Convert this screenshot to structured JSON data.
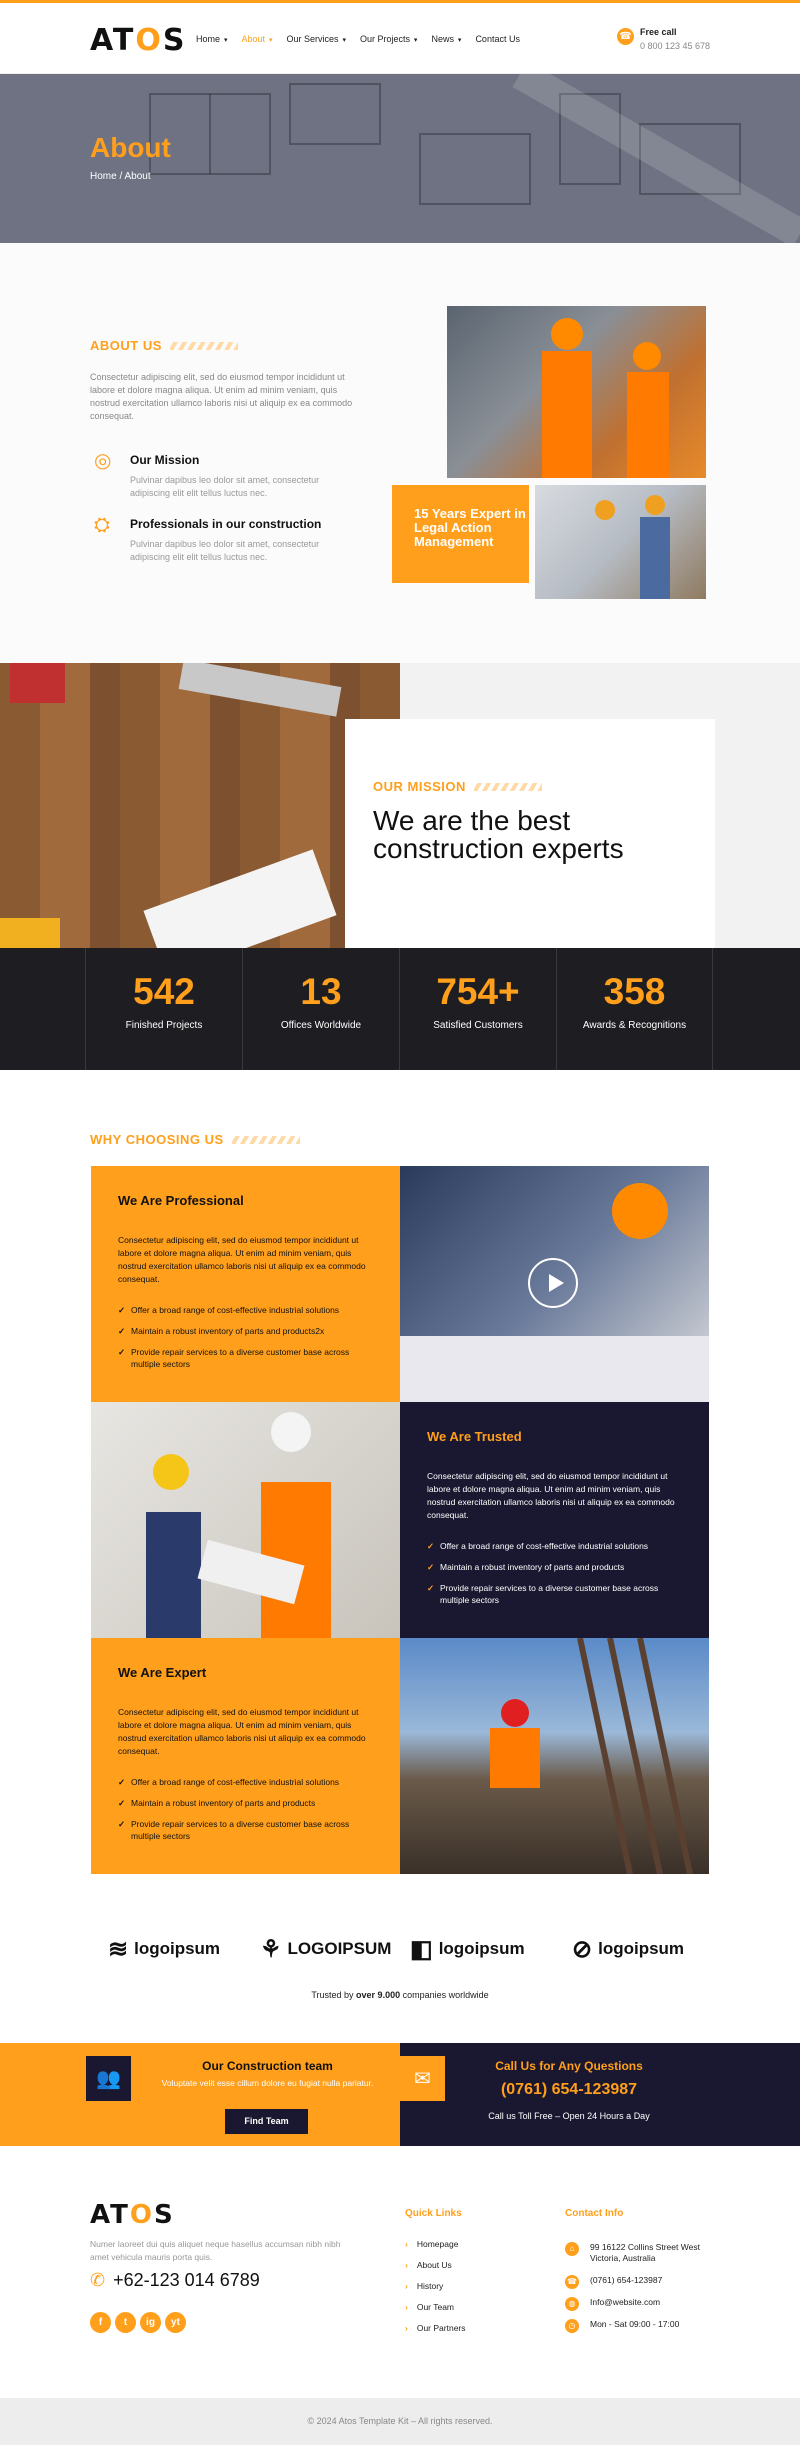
{
  "header": {
    "logo_pre": "AT",
    "logo_o": "O",
    "logo_post": "S",
    "nav": [
      {
        "label": "Home"
      },
      {
        "label": "About"
      },
      {
        "label": "Our Services"
      },
      {
        "label": "Our Projects"
      },
      {
        "label": "News"
      },
      {
        "label": "Contact Us"
      }
    ],
    "call_title": "Free call",
    "call_number": "0 800 123 45 678"
  },
  "hero": {
    "title": "About",
    "breadcrumb": "Home / About"
  },
  "about": {
    "eyebrow": "ABOUT US",
    "description": "Consectetur adipiscing elit, sed do eiusmod tempor incididunt ut labore et dolore magna aliqua. Ut enim ad minim veniam, quis nostrud exercitation ullamco laboris nisi ut aliquip ex ea commodo consequat.",
    "features": [
      {
        "icon": "target-icon",
        "title": "Our Mission",
        "text": "Pulvinar dapibus leo dolor sit amet, consectetur adipiscing elit elit tellus luctus nec."
      },
      {
        "icon": "crane-icon",
        "title": "Professionals in our construction",
        "text": "Pulvinar dapibus leo dolor sit amet, consectetur adipiscing elit elit tellus luctus nec."
      }
    ],
    "badge": "15 Years Expert in Legal Action Management"
  },
  "mission": {
    "eyebrow": "OUR MISSION",
    "heading": "We are the best construction experts"
  },
  "stats": [
    {
      "number": "542",
      "label": "Finished Projects"
    },
    {
      "number": "13",
      "label": "Offices Worldwide"
    },
    {
      "number": "754+",
      "label": "Satisfied Customers"
    },
    {
      "number": "358",
      "label": "Awards & Recognitions"
    }
  ],
  "why": {
    "eyebrow": "WHY CHOOSING US",
    "blocks": [
      {
        "title": "We Are Professional",
        "text": "Consectetur adipiscing elit, sed do eiusmod tempor incididunt ut labore et dolore magna aliqua. Ut enim ad minim veniam, quis nostrud exercitation ullamco laboris nisi ut aliquip ex ea commodo consequat.",
        "items": [
          "Offer a broad range of cost-effective industrial solutions",
          "Maintain a robust inventory of parts and products2x",
          "Provide repair services to a diverse customer base across multiple sectors"
        ]
      },
      {
        "title": "We Are Trusted",
        "text": "Consectetur adipiscing elit, sed do eiusmod tempor incididunt ut labore et dolore magna aliqua. Ut enim ad minim veniam, quis nostrud exercitation ullamco laboris nisi ut aliquip ex ea commodo consequat.",
        "items": [
          "Offer a broad range of cost-effective industrial solutions",
          "Maintain a robust inventory of parts and products",
          "Provide repair services to a diverse customer base across multiple sectors"
        ]
      },
      {
        "title": "We Are Expert",
        "text": "Consectetur adipiscing elit, sed do eiusmod tempor incididunt ut labore et dolore magna aliqua. Ut enim ad minim veniam, quis nostrud exercitation ullamco laboris nisi ut aliquip ex ea commodo consequat.",
        "items": [
          "Offer a broad range of cost-effective industrial solutions",
          "Maintain a robust inventory of parts and products",
          "Provide repair services to a diverse customer base across multiple sectors"
        ]
      }
    ]
  },
  "partners": {
    "logos": [
      "logoipsum",
      "LOGOIPSUM",
      "logoipsum",
      "logoipsum"
    ],
    "trusted_pre": "Trusted by ",
    "trusted_count": "over 9.000",
    "trusted_post": " companies worldwide"
  },
  "cta": {
    "team_title": "Our Construction team",
    "team_text": "Voluptate velit esse cillum dolore eu fugiat nulla pariatur.",
    "team_button": "Find Team",
    "call_title": "Call Us for Any Questions",
    "call_number": "(0761) 654-123987",
    "call_text": "Call us Toll Free – Open 24 Hours a Day"
  },
  "footer": {
    "description": "Numer laoreet dui quis aliquet neque hasellus accumsan nibh nibh amet vehicula mauris porta quis.",
    "phone": "+62-123 014 6789",
    "socials": [
      "f",
      "t",
      "ig",
      "yt"
    ],
    "quick_links_title": "Quick Links",
    "quick_links": [
      "Homepage",
      "About Us",
      "History",
      "Our Team",
      "Our Partners"
    ],
    "contact_title": "Contact Info",
    "contact": [
      {
        "icon": "map-icon",
        "text": "99 16122 Collins Street West Victoria, Australia"
      },
      {
        "icon": "phone-icon",
        "text": "(0761) 654-123987"
      },
      {
        "icon": "globe-icon",
        "text": "Info@website.com"
      },
      {
        "icon": "clock-icon",
        "text": "Mon - Sat 09:00 - 17:00"
      }
    ],
    "copyright": "© 2024 Atos Template Kit – All rights reserved."
  },
  "colors": {
    "accent": "#ff9f1c",
    "dark": "#1a1830"
  }
}
